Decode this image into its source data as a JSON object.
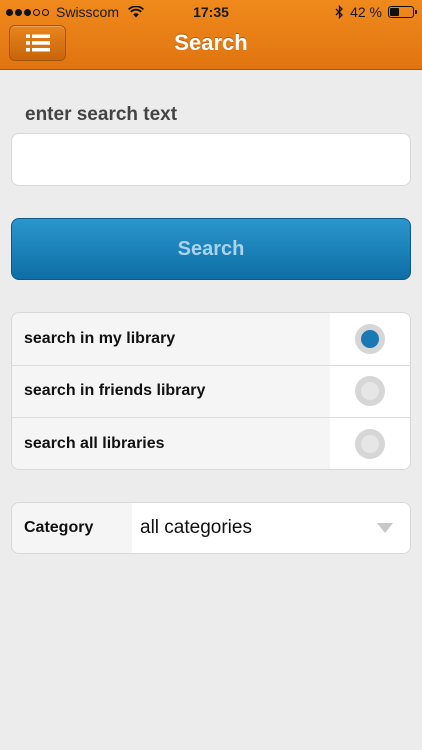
{
  "status_bar": {
    "carrier": "Swisscom",
    "time": "17:35",
    "battery": "42 %",
    "battery_level": 0.42,
    "signal_bars_filled": 3,
    "signal_bars_total": 5,
    "icons": [
      "wifi-icon",
      "bluetooth-icon",
      "battery-icon"
    ]
  },
  "nav": {
    "title": "Search",
    "menu_icon": "list-icon"
  },
  "search": {
    "label": "enter search text",
    "value": "",
    "placeholder": "",
    "button_label": "Search"
  },
  "options": [
    {
      "label": "search in my library",
      "selected": true
    },
    {
      "label": "search in friends library",
      "selected": false
    },
    {
      "label": "search all libraries",
      "selected": false
    }
  ],
  "category": {
    "label": "Category",
    "value": "all categories"
  },
  "colors": {
    "header": "#e8801a",
    "button": "#1a7fb8",
    "radio_selected": "#1a78b4",
    "background": "#ececec"
  }
}
